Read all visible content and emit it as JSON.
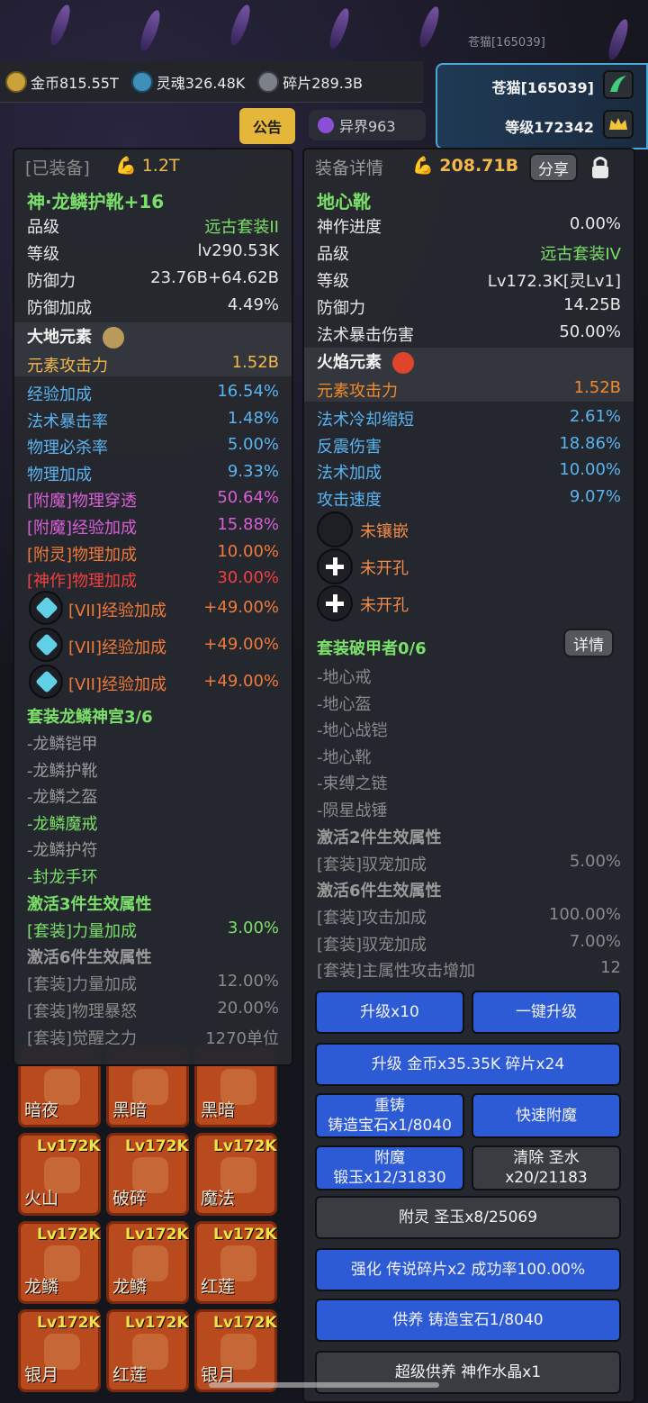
{
  "resources": [
    {
      "icon": "gold-coin-icon",
      "label": "金币815.55T"
    },
    {
      "icon": "soul-icon",
      "label": "灵魂326.48K"
    },
    {
      "icon": "shard-icon",
      "label": "碎片289.3B"
    }
  ],
  "player": {
    "name": "苍猫[165039]",
    "level": "等级172342",
    "ghost_name": "苍猫[165039]"
  },
  "notice_label": "公告",
  "realm_label": "异界963",
  "left": {
    "header": "[已装备]",
    "power": "1.2T",
    "item_name": "神·龙鳞护靴+16",
    "rows": [
      {
        "k": "品级",
        "v": "远古套装II",
        "kc": "#e8e8e8",
        "vc": "#7be06a"
      },
      {
        "k": "等级",
        "v": "lv290.53K",
        "kc": "#e8e8e8",
        "vc": "#e8e8e8"
      },
      {
        "k": "防御力",
        "v": "23.76B+64.62B",
        "kc": "#e8e8e8",
        "vc": "#e8e8e8"
      },
      {
        "k": "防御加成",
        "v": "4.49%",
        "kc": "#e8e8e8",
        "vc": "#e8e8e8"
      }
    ],
    "element": "大地元素",
    "element_row": {
      "k": "元素攻击力",
      "v": "1.52B"
    },
    "attrs": [
      {
        "k": "经验加成",
        "v": "16.54%",
        "c": "#5ab4f0"
      },
      {
        "k": "法术暴击率",
        "v": "1.48%",
        "c": "#5ab4f0"
      },
      {
        "k": "物理必杀率",
        "v": "5.00%",
        "c": "#5ab4f0"
      },
      {
        "k": "物理加成",
        "v": "9.33%",
        "c": "#5ab4f0"
      },
      {
        "k": "[附魔]物理穿透",
        "v": "50.64%",
        "c": "#d95fd6"
      },
      {
        "k": "[附魔]经验加成",
        "v": "15.88%",
        "c": "#d95fd6"
      },
      {
        "k": "[附灵]物理加成",
        "v": "10.00%",
        "c": "#f07a3a"
      },
      {
        "k": "[神作]物理加成",
        "v": "30.00%",
        "c": "#f04040"
      }
    ],
    "gems": [
      {
        "k": "[VII]经验加成",
        "v": "+49.00%"
      },
      {
        "k": "[VII]经验加成",
        "v": "+49.00%"
      },
      {
        "k": "[VII]经验加成",
        "v": "+49.00%"
      }
    ],
    "set_title": "套装龙鳞神宫3/6",
    "set_items": [
      {
        "t": "-龙鳞铠甲",
        "c": "#9a9a9a"
      },
      {
        "t": "-龙鳞护靴",
        "c": "#9a9a9a"
      },
      {
        "t": "-龙鳞之盔",
        "c": "#9a9a9a"
      },
      {
        "t": "-龙鳞魔戒",
        "c": "#7be06a"
      },
      {
        "t": "-龙鳞护符",
        "c": "#9a9a9a"
      },
      {
        "t": "-封龙手环",
        "c": "#7be06a"
      }
    ],
    "set3_title": "激活3件生效属性",
    "set3_row": {
      "k": "[套装]力量加成",
      "v": "3.00%"
    },
    "set6_title": "激活6件生效属性",
    "set6_rows": [
      {
        "k": "[套装]力量加成",
        "v": "12.00%"
      },
      {
        "k": "[套装]物理暴怒",
        "v": "20.00%"
      },
      {
        "k": "[套装]觉醒之力",
        "v": "1270单位"
      }
    ]
  },
  "right": {
    "header": "装备详情",
    "power": "208.71B",
    "share_label": "分享",
    "item_name": "地心靴",
    "rows": [
      {
        "k": "神作进度",
        "v": "0.00%",
        "vc": "#e8e8e8"
      },
      {
        "k": "品级",
        "v": "远古套装IV",
        "vc": "#7be06a"
      },
      {
        "k": "等级",
        "v": "Lv172.3K[灵Lv1]",
        "vc": "#e8e8e8"
      },
      {
        "k": "防御力",
        "v": "14.25B",
        "vc": "#e8e8e8"
      },
      {
        "k": "法术暴击伤害",
        "v": "50.00%",
        "vc": "#e8e8e8"
      }
    ],
    "element": "火焰元素",
    "element_row": {
      "k": "元素攻击力",
      "v": "1.52B"
    },
    "attrs": [
      {
        "k": "法术冷却缩短",
        "v": "2.61%"
      },
      {
        "k": "反震伤害",
        "v": "18.86%"
      },
      {
        "k": "法术加成",
        "v": "10.00%"
      },
      {
        "k": "攻击速度",
        "v": "9.07%"
      }
    ],
    "sockets": [
      {
        "label": "未镶嵌",
        "type": "empty"
      },
      {
        "label": "未开孔",
        "type": "plus"
      },
      {
        "label": "未开孔",
        "type": "plus"
      }
    ],
    "set_title": "套装破甲者0/6",
    "detail_label": "详情",
    "set_items": [
      "-地心戒",
      "-地心盔",
      "-地心战铠",
      "-地心靴",
      "-束缚之链",
      "-陨星战锤"
    ],
    "set2_title": "激活2件生效属性",
    "set2_row": {
      "k": "[套装]驭宠加成",
      "v": "5.00%"
    },
    "set6_title": "激活6件生效属性",
    "set6_rows": [
      {
        "k": "[套装]攻击加成",
        "v": "100.00%"
      },
      {
        "k": "[套装]驭宠加成",
        "v": "7.00%"
      },
      {
        "k": "[套装]主属性攻击增加",
        "v": "12"
      }
    ],
    "buttons": {
      "upgrade_x10": "升级x10",
      "upgrade_all": "一键升级",
      "upgrade_cost": "升级 金币x35.35K 碎片x24",
      "recast": "重铸",
      "recast_cost": "铸造宝石x1/8040",
      "quick_enchant": "快速附魔",
      "enchant": "附魔",
      "enchant_cost": "锻玉x12/31830",
      "clear": "清除 圣水x20/21183",
      "spirit": "附灵 圣玉x8/25069",
      "strengthen": "强化 传说碎片x2 成功率100.00%",
      "offer": "供养 铸造宝石1/8040",
      "super_offer": "超级供养 神作水晶x1"
    }
  },
  "grid": [
    {
      "lv": "",
      "name": "暗夜"
    },
    {
      "lv": "",
      "name": "黑暗"
    },
    {
      "lv": "",
      "name": "黑暗"
    },
    {
      "lv": "Lv172K",
      "name": "火山"
    },
    {
      "lv": "Lv172K",
      "name": "破碎"
    },
    {
      "lv": "Lv172K",
      "name": "魔法"
    },
    {
      "lv": "Lv172K",
      "name": "龙鳞"
    },
    {
      "lv": "Lv172K",
      "name": "龙鳞"
    },
    {
      "lv": "Lv172K",
      "name": "红莲"
    },
    {
      "lv": "Lv172K",
      "name": "银月"
    },
    {
      "lv": "Lv172K",
      "name": "红莲"
    },
    {
      "lv": "Lv172K",
      "name": "银月"
    }
  ],
  "colors": {
    "gold": "#f2b84a",
    "green": "#7be06a",
    "blue": "#5ab4f0",
    "button_blue": "#2d5bd6"
  }
}
